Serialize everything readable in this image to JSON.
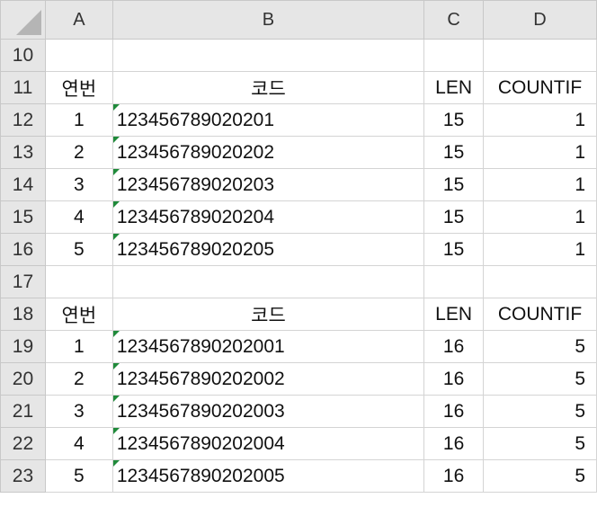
{
  "columns": [
    "A",
    "B",
    "C",
    "D"
  ],
  "rows": [
    {
      "num": "10",
      "a": "",
      "b": "",
      "c": "",
      "d": "",
      "type": "empty"
    },
    {
      "num": "11",
      "a": "연번",
      "b": "코드",
      "c": "LEN",
      "d": "COUNTIF",
      "type": "header"
    },
    {
      "num": "12",
      "a": "1",
      "b": "123456789020201",
      "c": "15",
      "d": "1",
      "type": "data"
    },
    {
      "num": "13",
      "a": "2",
      "b": "123456789020202",
      "c": "15",
      "d": "1",
      "type": "data"
    },
    {
      "num": "14",
      "a": "3",
      "b": "123456789020203",
      "c": "15",
      "d": "1",
      "type": "data"
    },
    {
      "num": "15",
      "a": "4",
      "b": "123456789020204",
      "c": "15",
      "d": "1",
      "type": "data"
    },
    {
      "num": "16",
      "a": "5",
      "b": "123456789020205",
      "c": "15",
      "d": "1",
      "type": "data"
    },
    {
      "num": "17",
      "a": "",
      "b": "",
      "c": "",
      "d": "",
      "type": "empty"
    },
    {
      "num": "18",
      "a": "연번",
      "b": "코드",
      "c": "LEN",
      "d": "COUNTIF",
      "type": "header"
    },
    {
      "num": "19",
      "a": "1",
      "b": "1234567890202001",
      "c": "16",
      "d": "5",
      "type": "data"
    },
    {
      "num": "20",
      "a": "2",
      "b": "1234567890202002",
      "c": "16",
      "d": "5",
      "type": "data"
    },
    {
      "num": "21",
      "a": "3",
      "b": "1234567890202003",
      "c": "16",
      "d": "5",
      "type": "data"
    },
    {
      "num": "22",
      "a": "4",
      "b": "1234567890202004",
      "c": "16",
      "d": "5",
      "type": "data"
    },
    {
      "num": "23",
      "a": "5",
      "b": "1234567890202005",
      "c": "16",
      "d": "5",
      "type": "data"
    }
  ],
  "colors": {
    "header_bg": "#e6e6e6",
    "grid": "#d4d4d4",
    "error_indicator": "#1f8a3a"
  }
}
